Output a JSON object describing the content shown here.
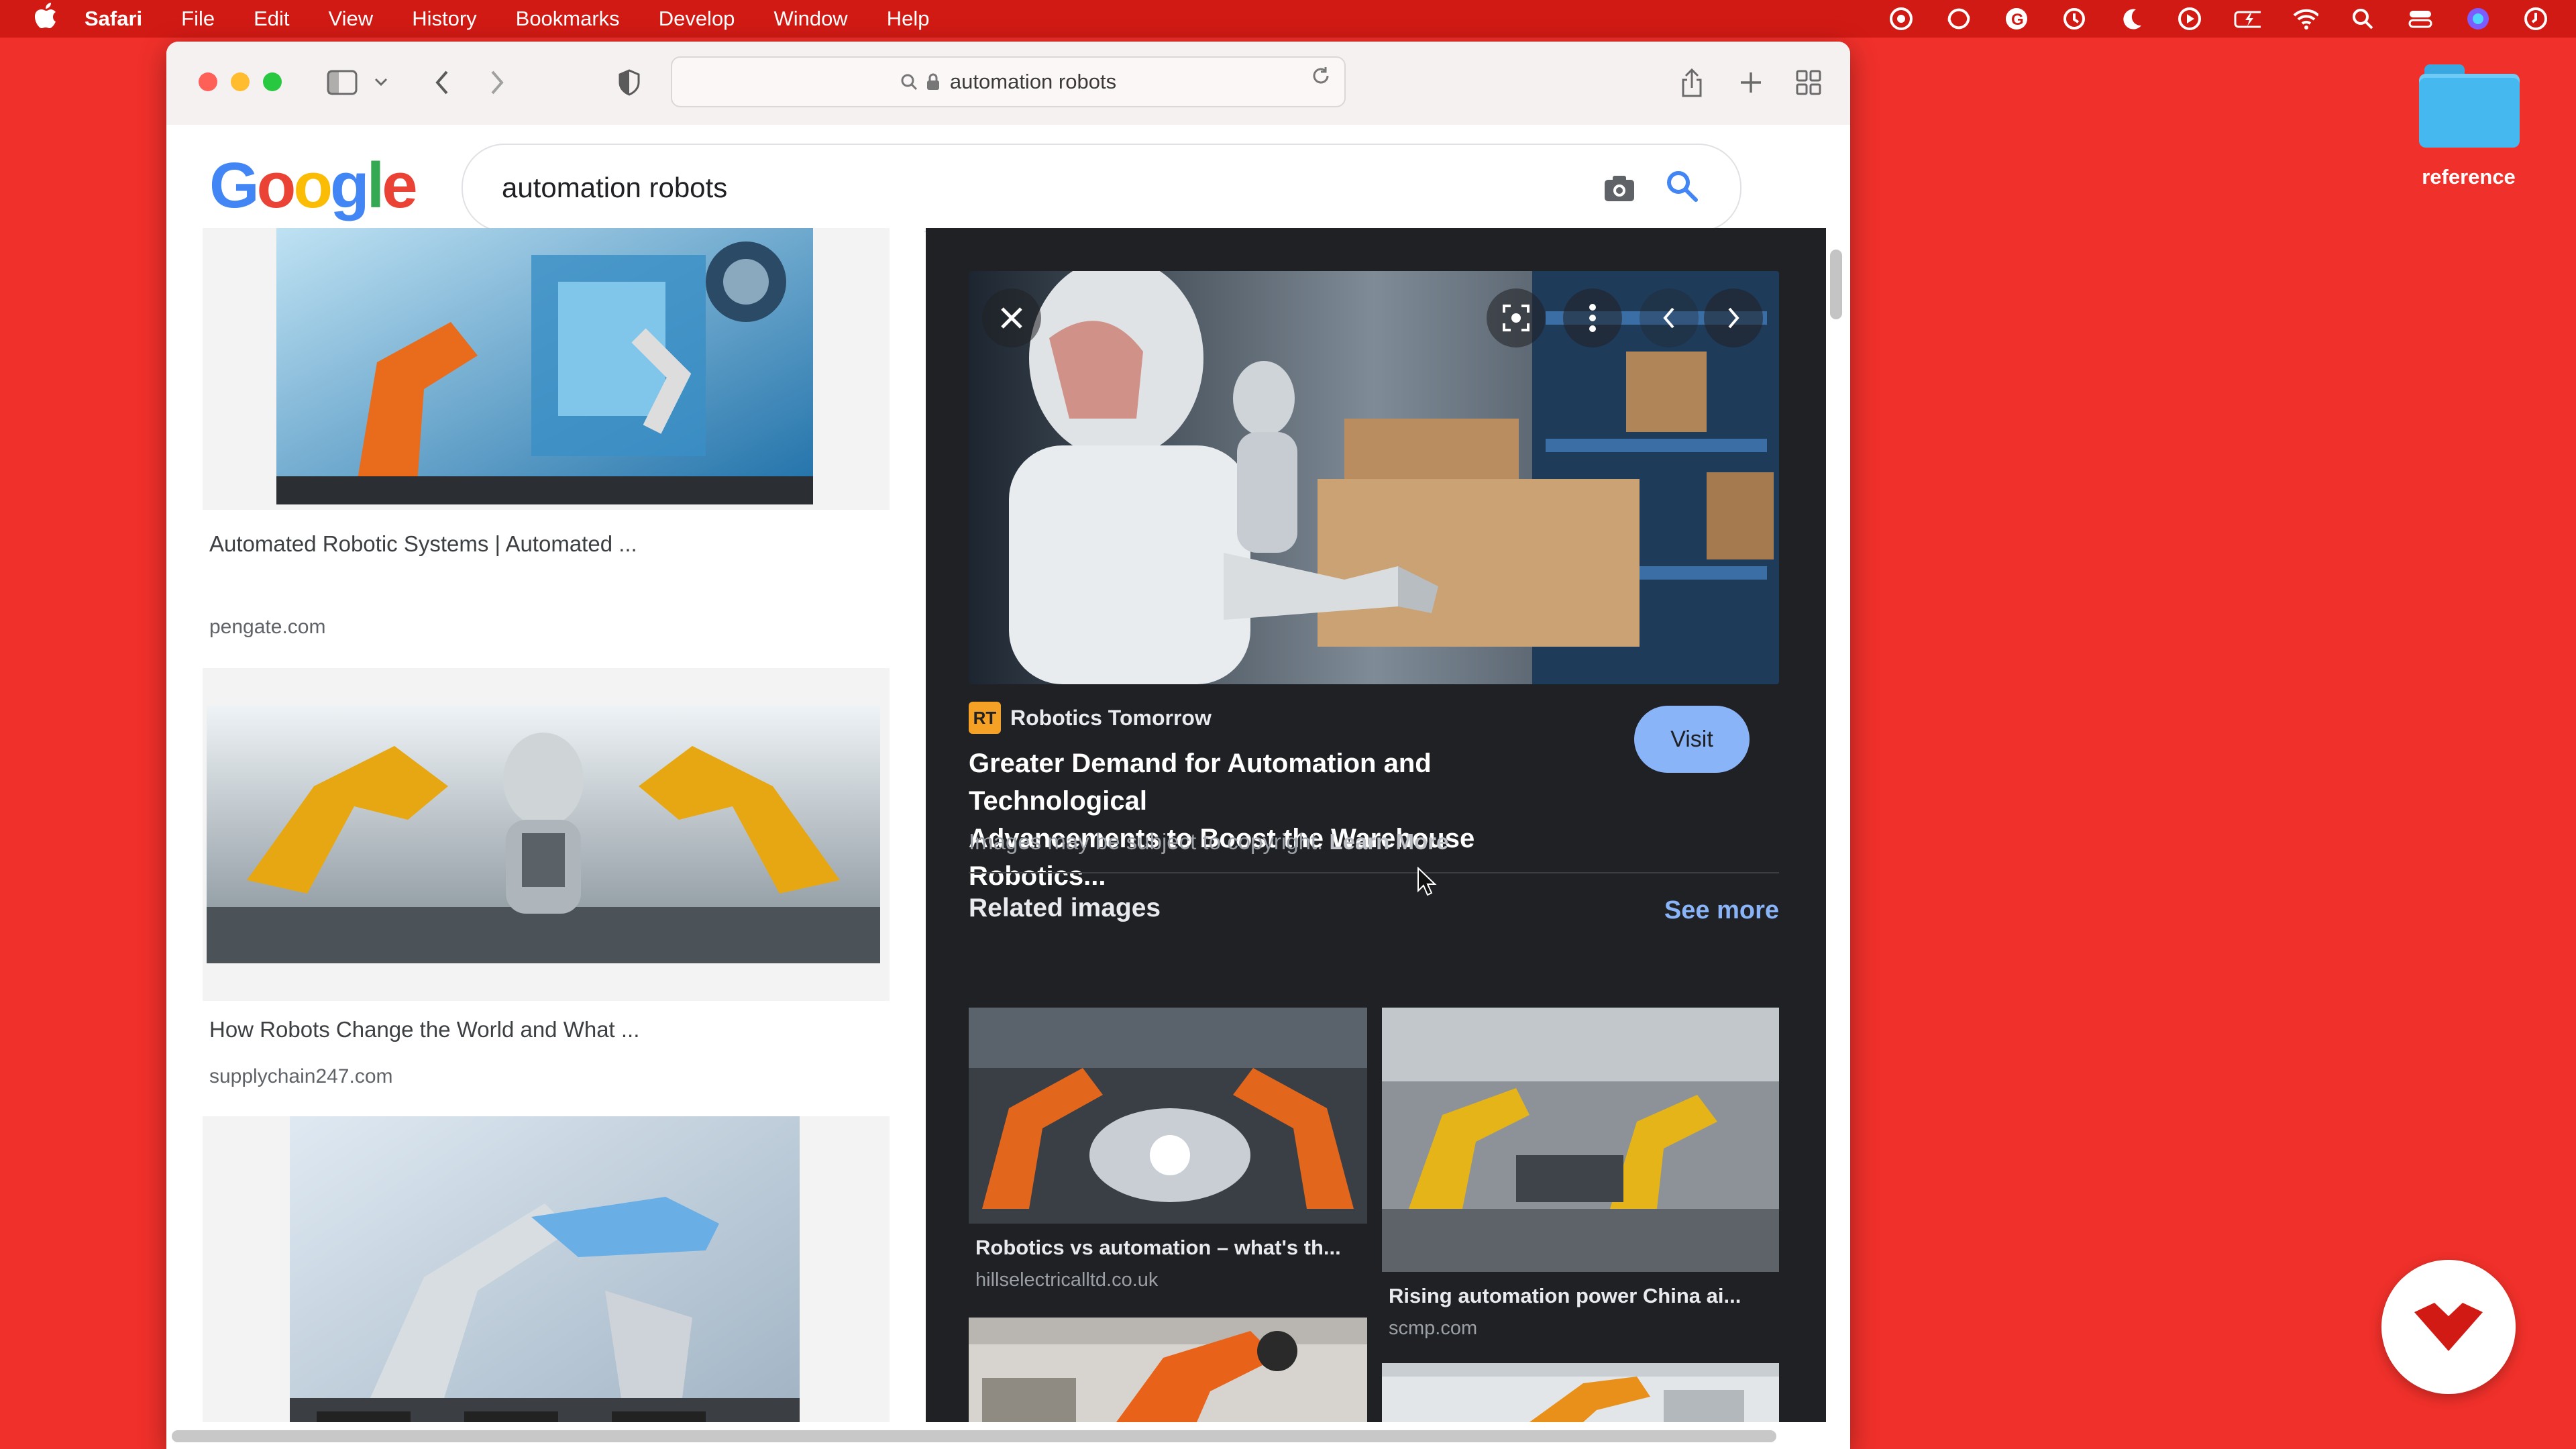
{
  "menubar": {
    "app": "Safari",
    "items": [
      "File",
      "Edit",
      "View",
      "History",
      "Bookmarks",
      "Develop",
      "Window",
      "Help"
    ],
    "status_icons": [
      "creative-cloud-icon",
      "sync-icon",
      "g-icon",
      "time-machine-icon",
      "moon-icon",
      "play-icon",
      "battery-icon",
      "wifi-icon",
      "spotlight-icon",
      "control-center-icon",
      "siri-icon",
      "clock-icon"
    ]
  },
  "desktop": {
    "folder_label": "reference"
  },
  "browser": {
    "url": "automation robots"
  },
  "google": {
    "logo_letters": [
      "G",
      "o",
      "o",
      "g",
      "l",
      "e"
    ],
    "logo_colors": [
      "#4285F4",
      "#EA4335",
      "#FBBC05",
      "#4285F4",
      "#34A853",
      "#EA4335"
    ],
    "query": "automation robots"
  },
  "results": [
    {
      "title": "Automated Robotic Systems | Automated ...",
      "source": "pengate.com"
    },
    {
      "title": "How Robots Change the World and What ...",
      "source": "supplychain247.com"
    },
    {
      "title": "",
      "source": ""
    }
  ],
  "preview": {
    "source_name": "Robotics Tomorrow",
    "source_favicon": "RT",
    "visit_label": "Visit",
    "headline_line1": "Greater Demand for Automation and Technological",
    "headline_line2": "Advancements to Boost the Warehouse Robotics...",
    "copyright_text": "Images may be subject to copyright.",
    "learn_more": "Learn More",
    "related_heading": "Related images",
    "see_more": "See more",
    "related": [
      {
        "title": "Robotics vs automation – what's th...",
        "source": "hillselectricalltd.co.uk"
      },
      {
        "title": "Rising automation power China ai...",
        "source": "scmp.com"
      }
    ]
  },
  "colors": {
    "desktop_bg": "#f0302a",
    "menubar_bg": "#d21a14",
    "panel_bg": "#202124",
    "accent_blue": "#8ab4f8"
  }
}
